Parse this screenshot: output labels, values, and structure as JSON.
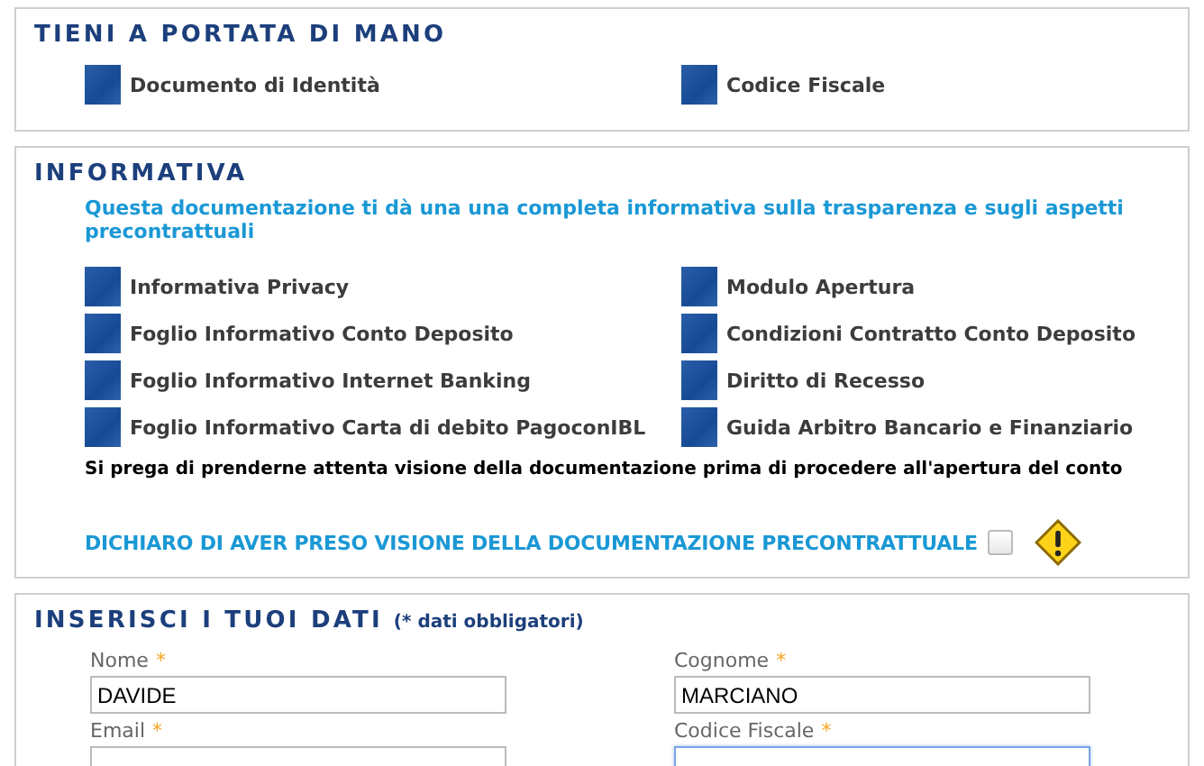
{
  "keep_at_hand": {
    "title": "TIENI A PORTATA DI MANO",
    "items": [
      {
        "label": "Documento di Identità"
      },
      {
        "label": "Codice Fiscale"
      }
    ]
  },
  "informativa": {
    "title": "INFORMATIVA",
    "intro": "Questa documentazione ti dà una una completa informativa sulla trasparenza e sugli aspetti precontrattuali",
    "documents": [
      {
        "label": "Informativa Privacy"
      },
      {
        "label": "Modulo Apertura"
      },
      {
        "label": "Foglio Informativo Conto Deposito"
      },
      {
        "label": "Condizioni Contratto Conto Deposito"
      },
      {
        "label": "Foglio Informativo Internet Banking"
      },
      {
        "label": "Diritto di Recesso"
      },
      {
        "label": "Foglio Informativo Carta di debito PagoconIBL"
      },
      {
        "label": "Guida Arbitro Bancario e Finanziario"
      }
    ],
    "note": "Si prega di prenderne attenta visione della documentazione prima di procedere all'apertura del conto",
    "declaration": {
      "label": "DICHIARO DI AVER PRESO VISIONE DELLA DOCUMENTAZIONE PRECONTRATTUALE",
      "checked": false,
      "warning": true
    }
  },
  "personal_data": {
    "title": "INSERISCI I TUOI DATI",
    "subtitle": "(* dati obbligatori)",
    "fields": [
      {
        "label": "Nome",
        "required_mark": "*",
        "value": "DAVIDE",
        "focused": false
      },
      {
        "label": "Cognome",
        "required_mark": "*",
        "value": "MARCIANO",
        "focused": false
      },
      {
        "label": "Email",
        "required_mark": "*",
        "focused": false
      },
      {
        "label": "Codice Fiscale",
        "required_mark": "*",
        "focused": true
      }
    ]
  }
}
